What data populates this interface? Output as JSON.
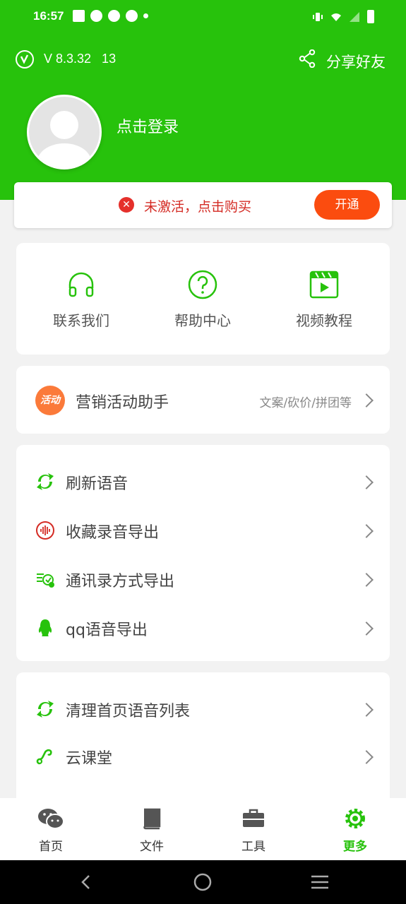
{
  "status_bar": {
    "time": "16:57"
  },
  "header": {
    "version": "V 8.3.32   13",
    "share_label": "分享好友",
    "login_label": "点击登录"
  },
  "activation": {
    "message": "未激活，点击购买",
    "button_label": "开通"
  },
  "quick_actions": [
    {
      "label": "联系我们",
      "icon": "headset-icon"
    },
    {
      "label": "帮助中心",
      "icon": "help-icon"
    },
    {
      "label": "视频教程",
      "icon": "video-icon"
    }
  ],
  "promo": {
    "icon_text": "活动",
    "title": "营销活动助手",
    "subtitle": "文案/砍价/拼团等"
  },
  "menu_group1": [
    {
      "label": "刷新语音",
      "icon": "refresh-icon"
    },
    {
      "label": "收藏录音导出",
      "icon": "audio-wave-icon"
    },
    {
      "label": "通讯录方式导出",
      "icon": "contacts-export-icon"
    },
    {
      "label": "qq语音导出",
      "icon": "qq-penguin-icon"
    }
  ],
  "menu_group2": [
    {
      "label": "清理首页语音列表",
      "icon": "refresh-icon"
    },
    {
      "label": "云课堂",
      "icon": "link-icon"
    }
  ],
  "bottom_nav": [
    {
      "label": "首页",
      "icon": "wechat-icon"
    },
    {
      "label": "文件",
      "icon": "book-icon"
    },
    {
      "label": "工具",
      "icon": "toolbox-icon"
    },
    {
      "label": "更多",
      "icon": "gear-icon",
      "active": true
    }
  ],
  "colors": {
    "brand_green": "#27c20c",
    "alert_red": "#e5302b",
    "button_orange": "#fb4c0f"
  }
}
